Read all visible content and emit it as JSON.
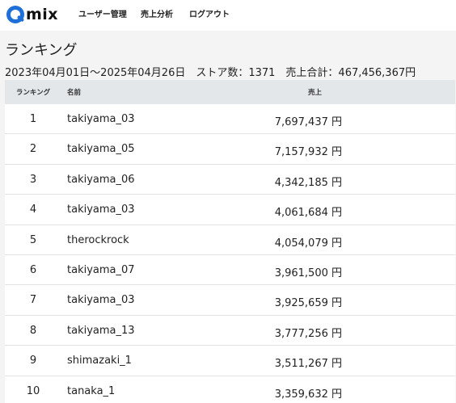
{
  "header": {
    "logo_q": "Q",
    "logo_text": "mix",
    "nav": [
      {
        "label": "ユーザー管理"
      },
      {
        "label": "売上分析"
      },
      {
        "label": "ログアウト"
      }
    ]
  },
  "page": {
    "title": "ランキング",
    "summary": "2023年04月01日～2025年04月26日　ストア数：1371　売上合計：467,456,367円"
  },
  "table": {
    "columns": {
      "rank": "ランキング",
      "name": "名前",
      "sales": "売上"
    },
    "rows": [
      {
        "rank": "1",
        "name": "takiyama_03",
        "sales": "7,697,437 円"
      },
      {
        "rank": "2",
        "name": "takiyama_05",
        "sales": "7,157,932 円"
      },
      {
        "rank": "3",
        "name": "takiyama_06",
        "sales": "4,342,185 円"
      },
      {
        "rank": "4",
        "name": "takiyama_03",
        "sales": "4,061,684 円"
      },
      {
        "rank": "5",
        "name": "therockrock",
        "sales": "4,054,079 円"
      },
      {
        "rank": "6",
        "name": "takiyama_07",
        "sales": "3,961,500 円"
      },
      {
        "rank": "7",
        "name": "takiyama_03",
        "sales": "3,925,659 円"
      },
      {
        "rank": "8",
        "name": "takiyama_13",
        "sales": "3,777,256 円"
      },
      {
        "rank": "9",
        "name": "shimazaki_1",
        "sales": "3,511,267 円"
      },
      {
        "rank": "10",
        "name": "tanaka_1",
        "sales": "3,359,632 円"
      }
    ]
  },
  "colors": {
    "brand": "#1f6fd9",
    "header_bg": "#e3e7ea",
    "page_bg": "#f4f4f4"
  }
}
